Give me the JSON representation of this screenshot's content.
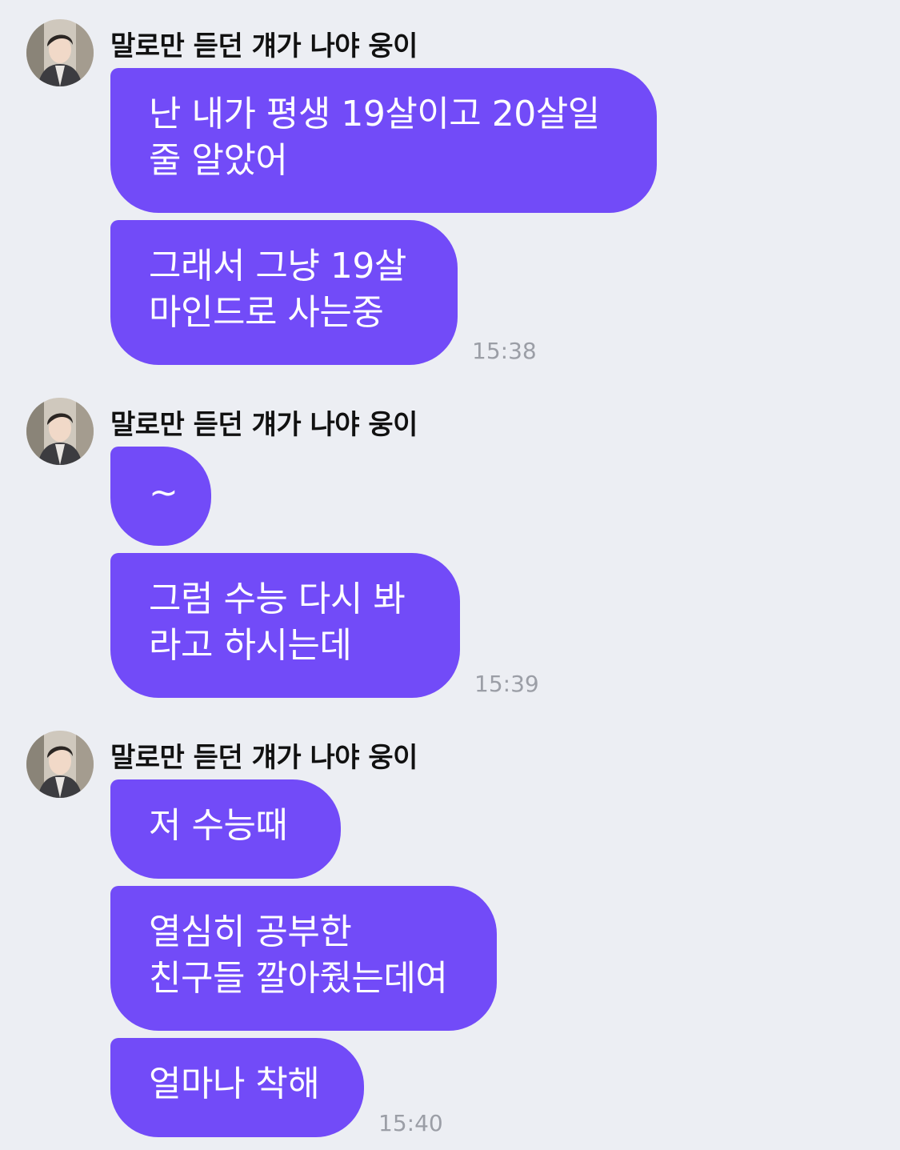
{
  "messages": [
    {
      "sender": "말로만 듣던 걔가 나야 웅이",
      "bubbles": [
        "난 내가 평생 19살이고 20살일\n줄 알았어",
        "그래서 그냥 19살\n마인드로 사는중"
      ],
      "time": "15:38"
    },
    {
      "sender": "말로만 듣던 걔가 나야 웅이",
      "bubbles": [
        "~",
        "그럼 수능 다시 봐\n라고 하시는데"
      ],
      "time": "15:39"
    },
    {
      "sender": "말로만 듣던 걔가 나야 웅이",
      "bubbles": [
        "저 수능때",
        "열심히 공부한\n친구들 깔아줬는데여",
        "얼마나 착해"
      ],
      "time": "15:40"
    }
  ],
  "colors": {
    "background": "#eceef3",
    "bubble": "#724bf8",
    "bubble_text": "#ffffff",
    "time_text": "#9b9ea6"
  },
  "icons": {
    "avatar": "profile-photo"
  }
}
